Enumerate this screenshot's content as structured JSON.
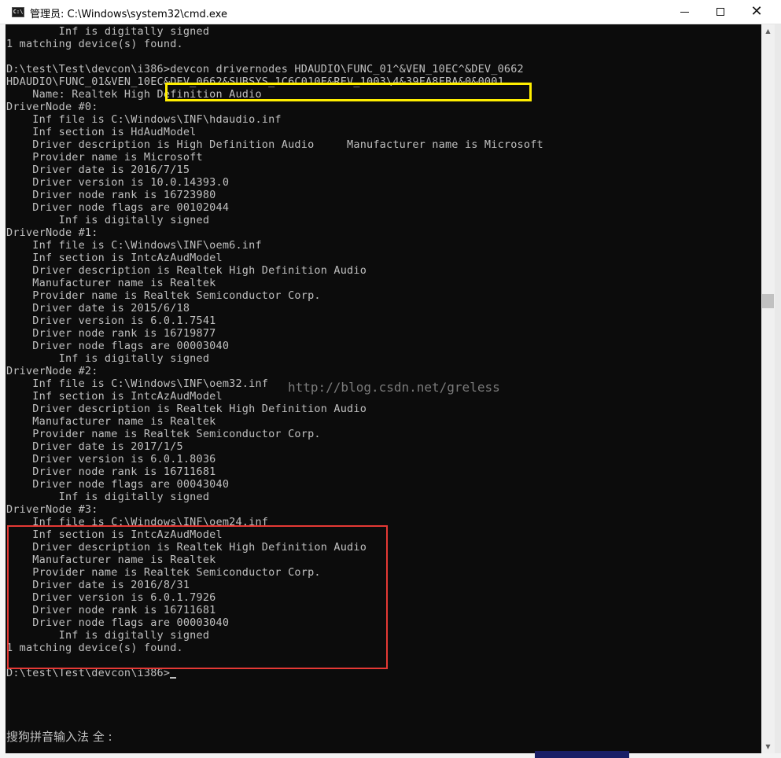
{
  "window": {
    "title": "管理员: C:\\Windows\\system32\\cmd.exe",
    "icon": "cmd-icon",
    "icon_text": "C:\\",
    "buttons": {
      "minimize": "minimize-icon",
      "maximize": "maximize-icon",
      "close": "✕"
    }
  },
  "console": {
    "lines": [
      "        Inf is digitally signed",
      "1 matching device(s) found.",
      "",
      "D:\\test\\Test\\devcon\\i386>devcon drivernodes HDAUDIO\\FUNC_01^&VEN_10EC^&DEV_0662",
      "HDAUDIO\\FUNC_01&VEN_10EC&DEV_0662&SUBSYS_1C6C010E&REV_1003\\4&39FA8FBA&0&0001",
      "    Name: Realtek High Definition Audio",
      "DriverNode #0:",
      "    Inf file is C:\\Windows\\INF\\hdaudio.inf",
      "    Inf section is HdAudModel",
      "    Driver description is High Definition Audio     Manufacturer name is Microsoft",
      "    Provider name is Microsoft",
      "    Driver date is 2016/7/15",
      "    Driver version is 10.0.14393.0",
      "    Driver node rank is 16723980",
      "    Driver node flags are 00102044",
      "        Inf is digitally signed",
      "DriverNode #1:",
      "    Inf file is C:\\Windows\\INF\\oem6.inf",
      "    Inf section is IntcAzAudModel",
      "    Driver description is Realtek High Definition Audio",
      "    Manufacturer name is Realtek",
      "    Provider name is Realtek Semiconductor Corp.",
      "    Driver date is 2015/6/18",
      "    Driver version is 6.0.1.7541",
      "    Driver node rank is 16719877",
      "    Driver node flags are 00003040",
      "        Inf is digitally signed",
      "DriverNode #2:",
      "    Inf file is C:\\Windows\\INF\\oem32.inf",
      "    Inf section is IntcAzAudModel",
      "    Driver description is Realtek High Definition Audio",
      "    Manufacturer name is Realtek",
      "    Provider name is Realtek Semiconductor Corp.",
      "    Driver date is 2017/1/5",
      "    Driver version is 6.0.1.8036",
      "    Driver node rank is 16711681",
      "    Driver node flags are 00043040",
      "        Inf is digitally signed",
      "DriverNode #3:",
      "    Inf file is C:\\Windows\\INF\\oem24.inf",
      "    Inf section is IntcAzAudModel",
      "    Driver description is Realtek High Definition Audio",
      "    Manufacturer name is Realtek",
      "    Provider name is Realtek Semiconductor Corp.",
      "    Driver date is 2016/8/31",
      "    Driver version is 6.0.1.7926",
      "    Driver node rank is 16711681",
      "    Driver node flags are 00003040",
      "        Inf is digitally signed",
      "1 matching device(s) found.",
      "",
      "D:\\test\\Test\\devcon\\i386>"
    ],
    "watermark": "http://blog.csdn.net/greless",
    "ime_status": "搜狗拼音输入法 全 :"
  },
  "colors": {
    "console_bg": "#0c0c0c",
    "console_text": "#c0c0c0",
    "highlight_command": "#ffee00",
    "highlight_node": "#e53935"
  },
  "scrollbar": {
    "up_icon": "▲",
    "down_icon": "▼"
  }
}
